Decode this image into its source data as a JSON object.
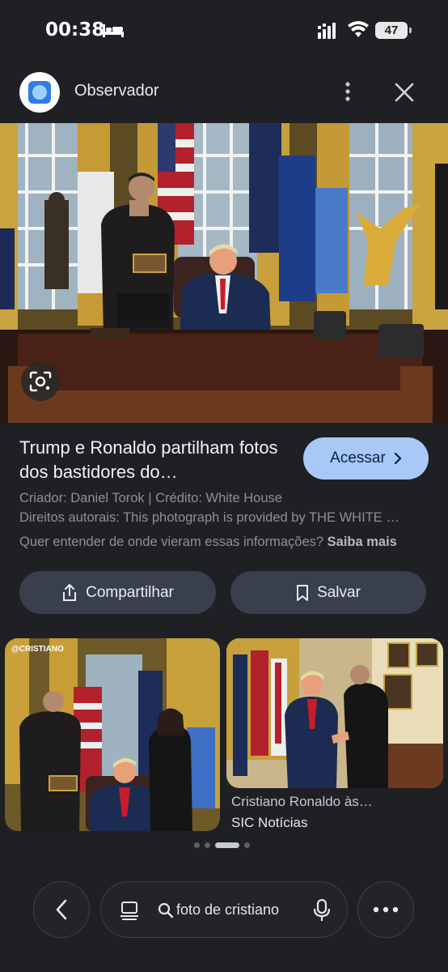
{
  "status_bar": {
    "time": "00:38",
    "battery": "47"
  },
  "header": {
    "site_name": "Observador"
  },
  "result": {
    "title": "Trump e Ronaldo partilham fotos dos bastidores do…",
    "access_label": "Acessar",
    "creator_line": "Criador: Daniel Torok | Crédito: White House",
    "rights_line": "Direitos autorais: This photograph is provided by THE WHITE …",
    "info_question": "Quer entender de onde vieram essas informações?",
    "learn_more": "Saiba mais"
  },
  "actions": {
    "share_label": "Compartilhar",
    "save_label": "Salvar"
  },
  "related": [
    {
      "watermark": "@CRISTIANO"
    },
    {
      "title": "Cristiano Ronaldo às…",
      "source": "SIC Notícias"
    }
  ],
  "search": {
    "query": "foto de cristiano"
  }
}
